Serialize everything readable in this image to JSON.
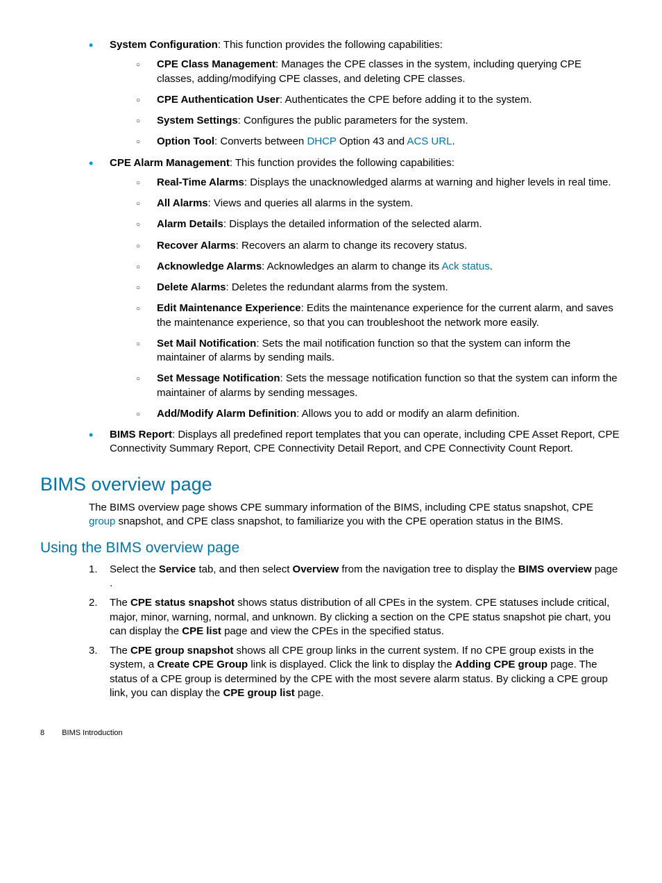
{
  "bullets": {
    "sysconf": {
      "label": "System Configuration",
      "desc": ": This function provides the following capabilities:",
      "items": [
        {
          "label": "CPE Class Management",
          "desc": ": Manages the CPE classes in the system, including querying CPE classes, adding/modifying CPE classes, and deleting CPE classes."
        },
        {
          "label": "CPE Authentication User",
          "desc": ": Authenticates the CPE before adding it to the system."
        },
        {
          "label": "System Settings",
          "desc": ": Configures the public parameters for the system."
        }
      ],
      "option_tool": {
        "label": "Option Tool",
        "pre": ": Converts between ",
        "link1": "DHCP",
        "mid": " Option 43 and ",
        "link2": "ACS URL",
        "post": "."
      }
    },
    "alarm": {
      "label": "CPE Alarm Management",
      "desc": ": This function provides the following capabilities:",
      "items_a": [
        {
          "label": "Real-Time Alarms",
          "desc": ": Displays the unacknowledged alarms at warning and higher levels in real time."
        },
        {
          "label": "All Alarms",
          "desc": ": Views and queries all alarms in the system."
        },
        {
          "label": "Alarm Details",
          "desc": ": Displays the detailed information of the selected alarm."
        },
        {
          "label": "Recover Alarms",
          "desc": ": Recovers an alarm to change its recovery status."
        }
      ],
      "ack": {
        "label": "Acknowledge Alarms",
        "pre": ": Acknowledges an alarm to change its ",
        "link": "Ack status",
        "post": "."
      },
      "items_b": [
        {
          "label": "Delete Alarms",
          "desc": ": Deletes the redundant alarms from the system."
        },
        {
          "label": "Edit Maintenance Experience",
          "desc": ": Edits the maintenance experience for the current alarm, and saves the maintenance experience, so that you can troubleshoot the network more easily."
        },
        {
          "label": "Set Mail Notification",
          "desc": ": Sets the mail notification function so that the system can inform the maintainer of alarms by sending mails."
        },
        {
          "label": "Set Message Notification",
          "desc": ": Sets the message notification function so that the system can inform the maintainer of alarms by sending messages."
        },
        {
          "label": "Add/Modify Alarm Definition",
          "desc": ": Allows you to add or modify an alarm definition."
        }
      ]
    },
    "report": {
      "label": "BIMS Report",
      "desc": ": Displays all predefined report templates that you can operate, including CPE Asset Report, CPE Connectivity Summary Report, CPE Connectivity Detail Report, and CPE Connectivity Count Report."
    }
  },
  "heading1": "BIMS overview page",
  "para1": {
    "pre": "The BIMS overview page shows CPE summary information of the BIMS, including CPE status snapshot, CPE ",
    "link": "group",
    "post": " snapshot, and CPE class snapshot, to familiarize you with the CPE operation status in the BIMS."
  },
  "heading2": "Using the BIMS overview page",
  "steps": {
    "s1": {
      "pre": "Select the ",
      "b1": "Service",
      "mid1": " tab, and then select ",
      "b2": "Overview",
      "mid2": " from the navigation tree to display the ",
      "b3": "BIMS overview",
      "post": " page ."
    },
    "s2": {
      "pre": "The ",
      "b1": "CPE status snapshot",
      "mid": " shows status distribution of all CPEs in the system. CPE statuses include critical, major, minor, warning, normal, and unknown. By clicking a section on the CPE status snapshot pie chart, you can display the ",
      "b2": "CPE list",
      "post": " page and view the CPEs in the specified status."
    },
    "s3": {
      "pre": "The ",
      "b1": "CPE group snapshot",
      "mid1": " shows all CPE group links in the current system. If no CPE group exists in the system, a ",
      "b2": "Create CPE Group",
      "mid2": " link is displayed. Click the link to display the ",
      "b3": "Adding CPE group",
      "mid3": " page. The status of a CPE group is determined by the CPE with the most severe alarm status. By clicking a CPE group link, you can display the ",
      "b4": "CPE group list",
      "post": " page."
    }
  },
  "footer": {
    "page": "8",
    "title": "BIMS Introduction"
  }
}
